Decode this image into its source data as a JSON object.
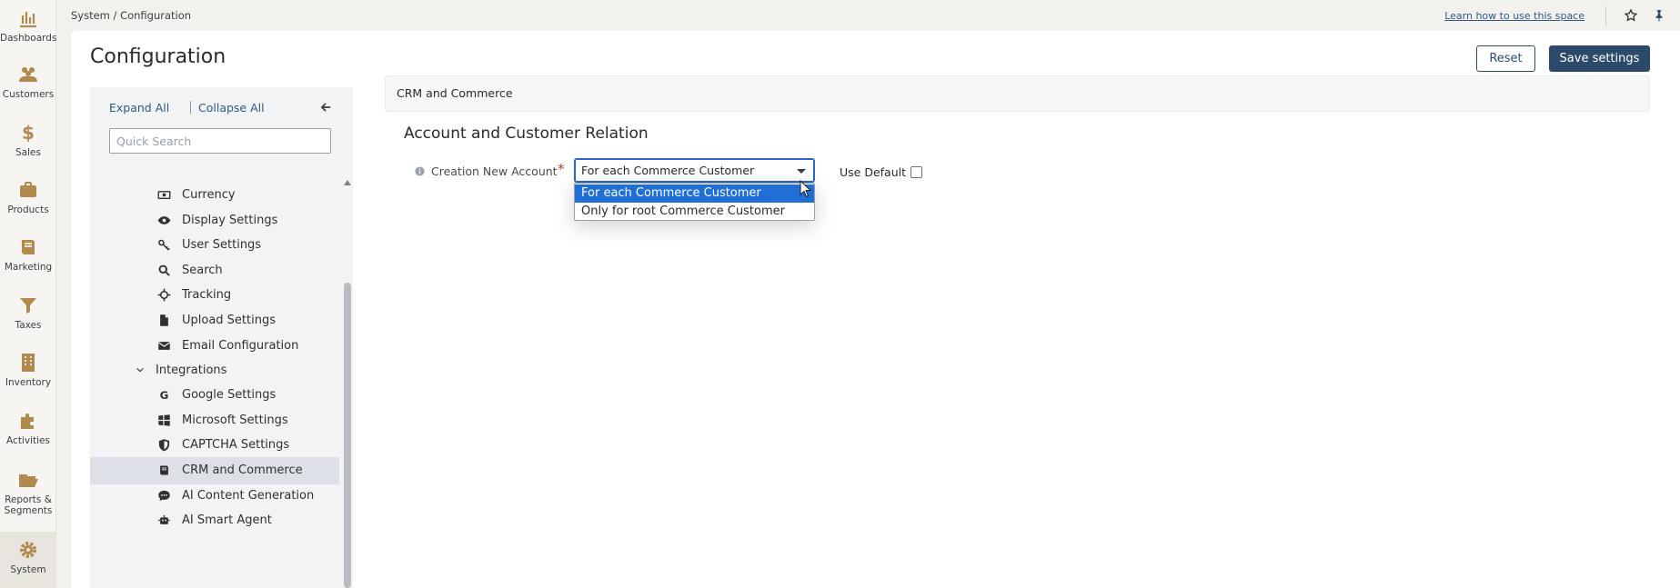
{
  "rail": {
    "items": [
      {
        "label": "Dashboards",
        "icon": "bar-chart-icon"
      },
      {
        "label": "Customers",
        "icon": "users-icon"
      },
      {
        "label": "Sales",
        "icon": "dollar-icon"
      },
      {
        "label": "Products",
        "icon": "briefcase-icon"
      },
      {
        "label": "Marketing",
        "icon": "book-icon"
      },
      {
        "label": "Taxes",
        "icon": "funnel-icon"
      },
      {
        "label": "Inventory",
        "icon": "building-icon"
      },
      {
        "label": "Activities",
        "icon": "puzzle-icon"
      },
      {
        "label": "Reports & Segments",
        "icon": "folder-open-icon"
      },
      {
        "label": "System",
        "icon": "gear-icon",
        "active": true
      }
    ]
  },
  "header": {
    "breadcrumb": "System / Configuration",
    "learn_link": "Learn how to use this space"
  },
  "page": {
    "title": "Configuration",
    "reset_label": "Reset",
    "save_label": "Save settings"
  },
  "tree": {
    "expand_all": "Expand All",
    "collapse_all": "Collapse All",
    "search_placeholder": "Quick Search",
    "items": [
      {
        "label": "Currency",
        "icon": "money-icon"
      },
      {
        "label": "Display Settings",
        "icon": "eye-icon"
      },
      {
        "label": "User Settings",
        "icon": "key-icon"
      },
      {
        "label": "Search",
        "icon": "search-icon"
      },
      {
        "label": "Tracking",
        "icon": "crosshair-icon"
      },
      {
        "label": "Upload Settings",
        "icon": "file-icon"
      },
      {
        "label": "Email Configuration",
        "icon": "envelope-icon"
      },
      {
        "label": "Integrations",
        "group": true
      },
      {
        "label": "Google Settings",
        "icon": "google-icon"
      },
      {
        "label": "Microsoft Settings",
        "icon": "windows-icon"
      },
      {
        "label": "CAPTCHA Settings",
        "icon": "shield-icon"
      },
      {
        "label": "CRM and Commerce",
        "icon": "book-icon",
        "active": true
      },
      {
        "label": "AI Content Generation",
        "icon": "chat-icon"
      },
      {
        "label": "AI Smart Agent",
        "icon": "robot-icon"
      }
    ]
  },
  "content": {
    "section_title": "CRM and Commerce",
    "group_title": "Account and Customer Relation",
    "field": {
      "label": "Creation New Account",
      "required_mark": "*",
      "value": "For each Commerce Customer",
      "use_default_label": "Use Default",
      "use_default_checked": false,
      "options": [
        "For each Commerce Customer",
        "Only for root Commerce Customer"
      ],
      "selected_index": 0
    }
  },
  "colors": {
    "accent": "#2e4a6b",
    "link": "#2e5a87",
    "icon": "#b08a4e",
    "selected_option": "#1f6fd6",
    "required": "#c0392b"
  }
}
